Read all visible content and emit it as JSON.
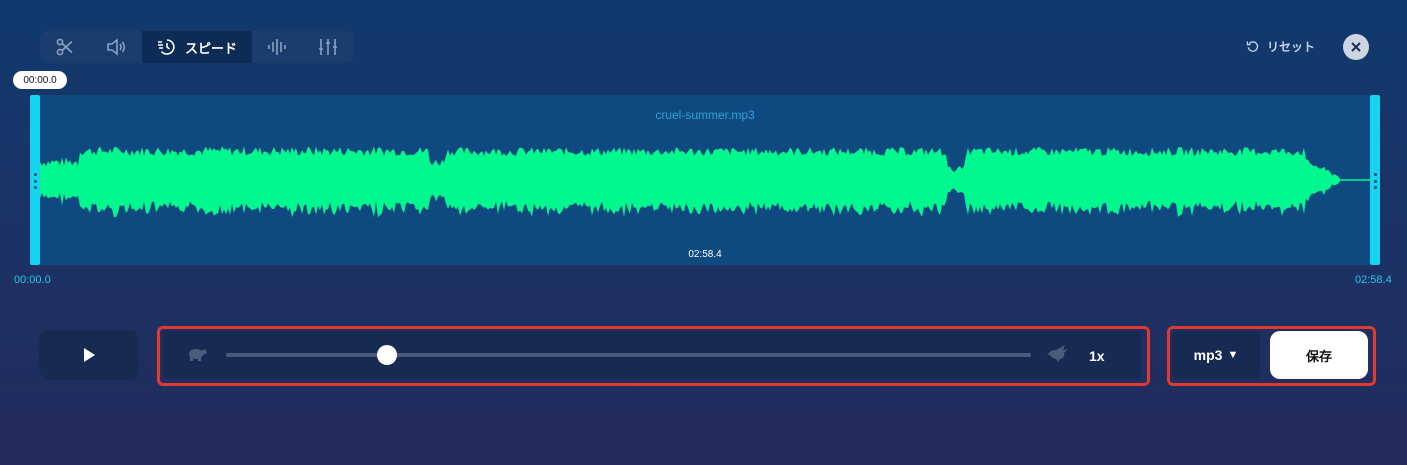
{
  "toolbar": {
    "tools": [
      {
        "name": "scissors-icon"
      },
      {
        "name": "volume-icon"
      },
      {
        "name": "speed-icon",
        "label": "スピード",
        "active": true
      },
      {
        "name": "waveform-icon"
      },
      {
        "name": "equalizer-icon"
      }
    ],
    "reset_label": "リセット"
  },
  "editor": {
    "filename": "cruel-summer.mp3",
    "duration_center": "02:58.4",
    "start_tooltip": "00:00.0",
    "time_start": "00:00.0",
    "time_end": "02:58.4"
  },
  "speed": {
    "value_label": "1x",
    "slider_fraction": 0.2
  },
  "output": {
    "format": "mp3",
    "save_label": "保存"
  },
  "colors": {
    "accent": "#17d3f0",
    "waveform": "#02f78f",
    "highlight": "#e03a2e"
  }
}
